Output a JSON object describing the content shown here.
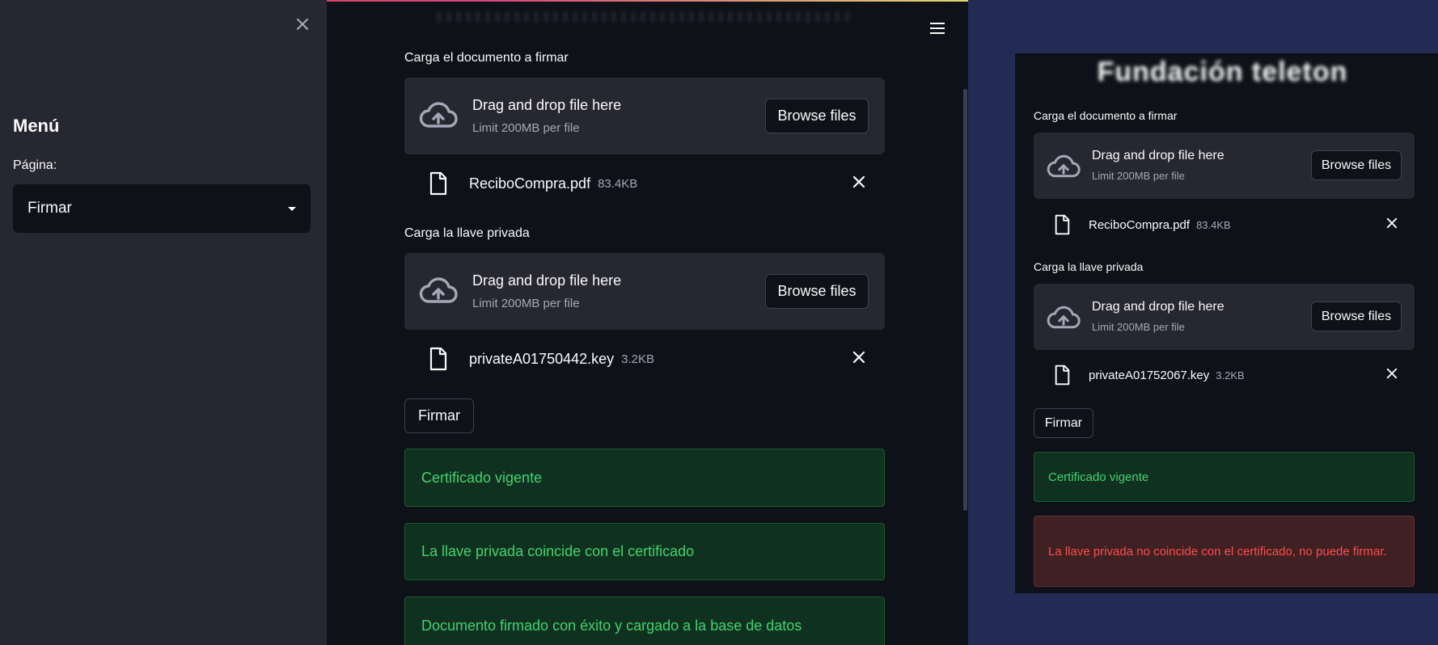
{
  "sidebar": {
    "close_symbol": "×",
    "menu_title": "Menú",
    "page_label": "Página:",
    "page_select_value": "Firmar"
  },
  "left": {
    "doc_label": "Carga el documento a firmar",
    "key_label": "Carga la llave privada",
    "dropzone_title": "Drag and drop file here",
    "dropzone_limit": "Limit 200MB per file",
    "browse_label": "Browse files",
    "doc_file": {
      "name": "ReciboCompra.pdf",
      "size": "83.4KB"
    },
    "key_file": {
      "name": "privateA01750442.key",
      "size": "3.2KB"
    },
    "sign_button": "Firmar",
    "alerts": [
      "Certificado vigente",
      "La llave privada coincide con el certificado",
      "Documento firmado con éxito y cargado a la base de datos"
    ]
  },
  "right": {
    "brand_title": "Fundación teleton",
    "doc_label": "Carga el documento a firmar",
    "key_label": "Carga la llave privada",
    "dropzone_title": "Drag and drop file here",
    "dropzone_limit": "Limit 200MB per file",
    "browse_label": "Browse files",
    "doc_file": {
      "name": "ReciboCompra.pdf",
      "size": "83.4KB"
    },
    "key_file": {
      "name": "privateA01752067.key",
      "size": "3.2KB"
    },
    "sign_button": "Firmar",
    "success_alert": "Certificado vigente",
    "error_alert": "La llave privada no coincide con el certificado, no puede firmar."
  },
  "icons": [
    "close-icon",
    "menu-icon",
    "upload-cloud-icon",
    "file-icon",
    "remove-icon",
    "dropdown-caret-icon"
  ],
  "colors": {
    "app_bg": "#0e1117",
    "sidebar_bg": "#262730",
    "outer_bg": "#232b54",
    "success_text": "#3dd56d",
    "success_bg": "#10311f",
    "error_text": "#ff4b4b",
    "error_bg": "#3f2124"
  }
}
